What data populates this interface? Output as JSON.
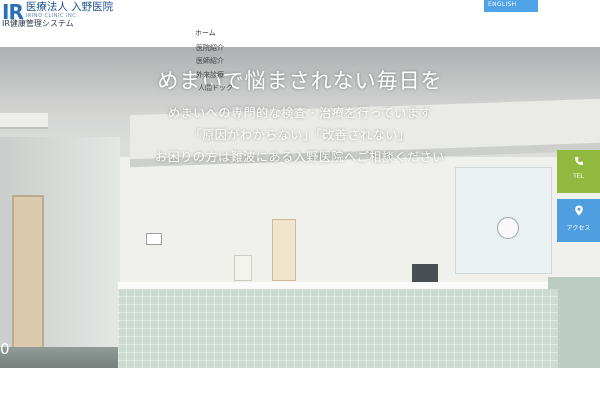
{
  "header": {
    "logo_mark": "IR",
    "logo_title": "医療法人 入野医院",
    "logo_sub": "IRINO CLINIC INC.",
    "system_title": "IR健康管理システム",
    "english_label": "ENGLISH",
    "nav_home": "ホーム"
  },
  "dropdown": {
    "items": [
      "医院紹介",
      "医師紹介",
      "外来診療",
      "人間ドック"
    ]
  },
  "hero": {
    "headline": "めまいで悩まされない毎日を",
    "lines": [
      "めまいへの専門的な検査・治療を行っています",
      "「原因がわからない」「改善されない」",
      "お困りの方は難波にある入野医院へご相談ください"
    ],
    "slide_number": "0"
  },
  "side": {
    "tel_icon": "phone-icon",
    "tel_label": "TEL",
    "access_icon": "map-pin-icon",
    "access_label": "アクセス"
  },
  "colors": {
    "brand_blue": "#2a6fb8",
    "english_button": "#4fa2e6",
    "tel_button": "#91b93f",
    "access_button": "#4f9fe0"
  }
}
